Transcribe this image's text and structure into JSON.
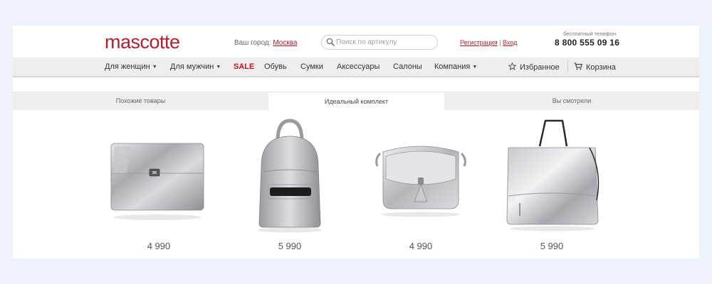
{
  "header": {
    "logo": "mascotte",
    "city_label": "Ваш город:",
    "city_value": "Москва",
    "search_placeholder": "Поиск по артикулу",
    "register_label": "Регистрация",
    "auth_separator": "|",
    "login_label": "Вход",
    "phone_label": "бесплатный телефон",
    "phone_number": "8 800 555 09 16"
  },
  "nav": {
    "items": [
      {
        "label": "Для женщин",
        "has_dropdown": true
      },
      {
        "label": "Для мужчин",
        "has_dropdown": true
      },
      {
        "label": "SALE",
        "has_dropdown": false
      },
      {
        "label": "Обувь",
        "has_dropdown": false
      },
      {
        "label": "Сумки",
        "has_dropdown": false
      },
      {
        "label": "Аксессуары",
        "has_dropdown": false
      },
      {
        "label": "Салоны",
        "has_dropdown": false
      },
      {
        "label": "Компания",
        "has_dropdown": true
      }
    ],
    "favorites_label": "Избранное",
    "cart_label": "Корзина",
    "dropdown_caret": "▼"
  },
  "tabs": [
    {
      "label": "Похожие товары",
      "active": false
    },
    {
      "label": "Идеальный комплект",
      "active": true
    },
    {
      "label": "Вы смотрели",
      "active": false
    }
  ],
  "products": [
    {
      "type": "clutch",
      "price": "4 990"
    },
    {
      "type": "backpack",
      "price": "5 990"
    },
    {
      "type": "saddle-bag",
      "price": "4 990"
    },
    {
      "type": "tote-bag",
      "price": "5 990"
    }
  ],
  "colors": {
    "brand": "#b21f2d",
    "sale": "#c8102e",
    "nav_bg": "#efeeec",
    "page_bg": "#eef3fb"
  },
  "icons": {
    "search": "search-icon",
    "favorites": "star-icon",
    "cart": "cart-icon"
  }
}
